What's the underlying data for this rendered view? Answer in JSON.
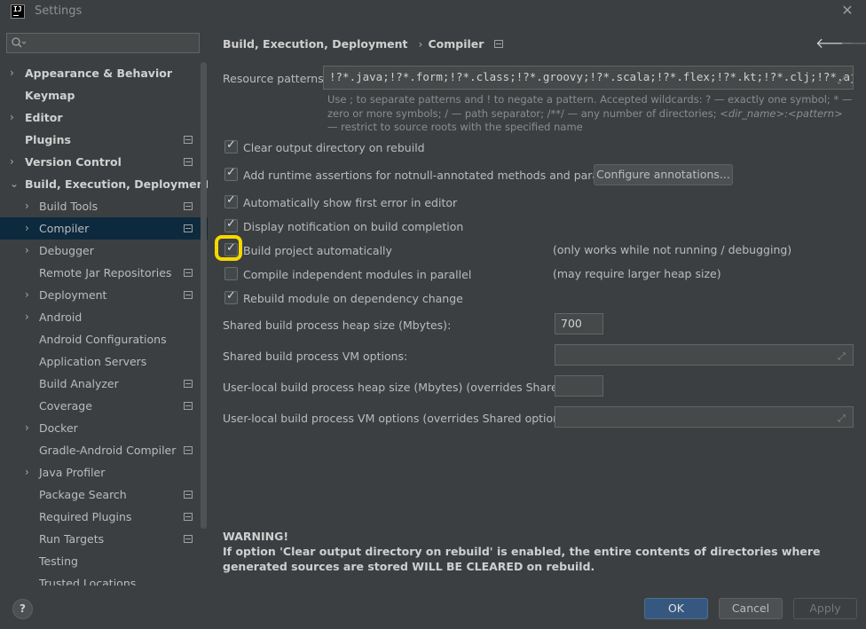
{
  "window": {
    "title": "Settings",
    "logo": "IJ"
  },
  "sidebar": {
    "search_placeholder": "",
    "items": [
      {
        "label": "Appearance & Behavior",
        "level": 0,
        "arrow": "›",
        "pm": false
      },
      {
        "label": "Keymap",
        "level": 0,
        "arrow": "",
        "pm": false
      },
      {
        "label": "Editor",
        "level": 0,
        "arrow": "›",
        "pm": false
      },
      {
        "label": "Plugins",
        "level": 0,
        "arrow": "",
        "pm": true
      },
      {
        "label": "Version Control",
        "level": 0,
        "arrow": "›",
        "pm": true
      },
      {
        "label": "Build, Execution, Deployment",
        "level": 0,
        "arrow": "⌄",
        "pm": false
      },
      {
        "label": "Build Tools",
        "level": 1,
        "arrow": "›",
        "pm": true
      },
      {
        "label": "Compiler",
        "level": 1,
        "arrow": "›",
        "pm": true,
        "selected": true
      },
      {
        "label": "Debugger",
        "level": 1,
        "arrow": "›",
        "pm": false
      },
      {
        "label": "Remote Jar Repositories",
        "level": 1,
        "arrow": "",
        "pm": true
      },
      {
        "label": "Deployment",
        "level": 1,
        "arrow": "›",
        "pm": true
      },
      {
        "label": "Android",
        "level": 1,
        "arrow": "›",
        "pm": false
      },
      {
        "label": "Android Configurations",
        "level": 1,
        "arrow": "",
        "pm": false
      },
      {
        "label": "Application Servers",
        "level": 1,
        "arrow": "",
        "pm": false
      },
      {
        "label": "Build Analyzer",
        "level": 1,
        "arrow": "",
        "pm": true
      },
      {
        "label": "Coverage",
        "level": 1,
        "arrow": "",
        "pm": true
      },
      {
        "label": "Docker",
        "level": 1,
        "arrow": "›",
        "pm": false
      },
      {
        "label": "Gradle-Android Compiler",
        "level": 1,
        "arrow": "",
        "pm": true
      },
      {
        "label": "Java Profiler",
        "level": 1,
        "arrow": "›",
        "pm": false
      },
      {
        "label": "Package Search",
        "level": 1,
        "arrow": "",
        "pm": true
      },
      {
        "label": "Required Plugins",
        "level": 1,
        "arrow": "",
        "pm": true
      },
      {
        "label": "Run Targets",
        "level": 1,
        "arrow": "",
        "pm": true
      },
      {
        "label": "Testing",
        "level": 1,
        "arrow": "",
        "pm": false
      },
      {
        "label": "Trusted Locations",
        "level": 1,
        "arrow": "",
        "pm": false
      }
    ]
  },
  "breadcrumb": {
    "parent": "Build, Execution, Deployment",
    "current": "Compiler"
  },
  "resource_patterns": {
    "label": "Resource patterns:",
    "value": "!?*.java;!?*.form;!?*.class;!?*.groovy;!?*.scala;!?*.flex;!?*.kt;!?*.clj;!?*.aj"
  },
  "hint": {
    "p1": "Use ; to separate patterns and ! to negate a pattern. Accepted wildcards: ? — exactly one symbol; * — zero or more symbols; / — path separator; /**/ — any number of directories; ",
    "p2": "<dir_name>:<pattern>",
    "p3": " — restrict to source roots with the specified name"
  },
  "options": {
    "clear_output": {
      "label": "Clear output directory on rebuild",
      "checked": true
    },
    "runtime_assertions": {
      "label": "Add runtime assertions for notnull-annotated methods and parameters",
      "checked": true
    },
    "configure_annotations": "Configure annotations...",
    "show_first_error": {
      "label": "Automatically show first error in editor",
      "checked": true
    },
    "display_notification": {
      "label": "Display notification on build completion",
      "checked": true
    },
    "build_auto": {
      "label": "Build project automatically",
      "checked": true,
      "note": "(only works while not running / debugging)"
    },
    "compile_parallel": {
      "label": "Compile independent modules in parallel",
      "checked": false,
      "note": "(may require larger heap size)"
    },
    "rebuild_dep": {
      "label": "Rebuild module on dependency change",
      "checked": true
    }
  },
  "fields": {
    "shared_heap": {
      "label": "Shared build process heap size (Mbytes):",
      "value": "700"
    },
    "shared_vm": {
      "label": "Shared build process VM options:",
      "value": ""
    },
    "user_heap": {
      "label": "User-local build process heap size (Mbytes) (overrides Shared size):",
      "value": ""
    },
    "user_vm": {
      "label": "User-local build process VM options (overrides Shared options):",
      "value": ""
    }
  },
  "warning": {
    "title": "WARNING!",
    "text": "If option 'Clear output directory on rebuild' is enabled, the entire contents of directories where generated sources are stored WILL BE CLEARED on rebuild."
  },
  "buttons": {
    "ok": "OK",
    "cancel": "Cancel",
    "apply": "Apply",
    "help": "?"
  },
  "colors": {
    "background": "#3c3f41",
    "selection": "#0d293e",
    "primary_button": "#365880",
    "highlight": "#f5d800"
  }
}
